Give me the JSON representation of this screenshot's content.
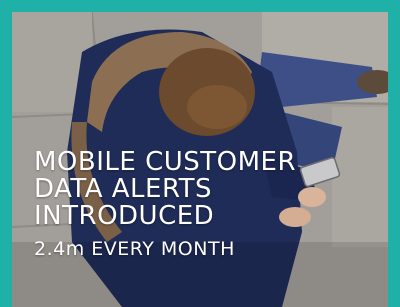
{
  "banner": {
    "headline_lines": [
      "MOBILE CUSTOMER",
      "DATA ALERTS",
      "INTRODUCED"
    ],
    "subline": "2.4m EVERY MONTH"
  },
  "colors": {
    "frame": "#1fb0a8",
    "text": "#ffffff"
  }
}
